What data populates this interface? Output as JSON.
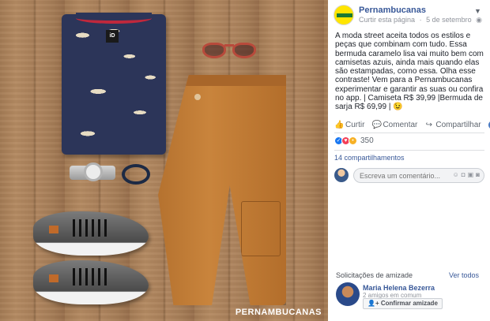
{
  "photo": {
    "watermark": "PERNAMBUCANAS"
  },
  "post": {
    "page_name": "Pernambucanas",
    "meta_follow": "Curtir esta página",
    "meta_sep": "·",
    "meta_date": "5 de setembro",
    "meta_privacy_icon": "globe-icon",
    "text": "A moda street aceita todos os estilos e peças que combinam com tudo. Essa bermuda caramelo lisa vai muito bem com camisetas azuis, ainda mais quando elas são estampadas, como essa. Olha esse contraste! Vem para a Pernambucanas experimentar e garantir as suas ou confira no app. | Camiseta R$ 39,99 |Bermuda de sarja R$ 69,99 | 😉",
    "actions": {
      "like": "Curtir",
      "comment": "Comentar",
      "share": "Compartilhar"
    },
    "reaction_count": "350",
    "shares": "14 compartilhamentos",
    "comment_placeholder": "Escreva um comentário..."
  },
  "friends": {
    "heading": "Solicitações de amizade",
    "see_all": "Ver todos",
    "name": "Maria Helena Bezerra",
    "mutual": "2 amigos em comum",
    "confirm": "Confirmar amizade"
  },
  "colors": {
    "link": "#385898",
    "muted": "#90949c",
    "like": "#1877f2",
    "love": "#f33e58",
    "wow": "#f7b125"
  }
}
